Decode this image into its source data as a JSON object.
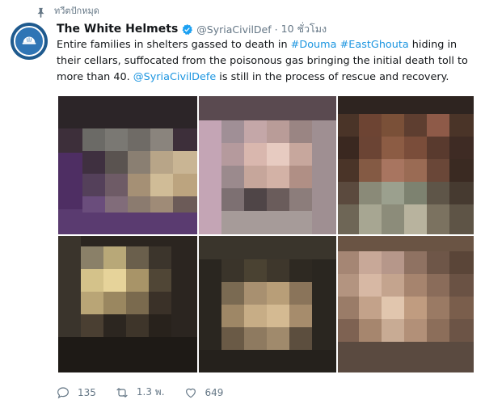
{
  "pinned_label": "ทวีตปักหมุด",
  "tweet": {
    "display_name": "The White Helmets",
    "handle": "@SyriaCivilDef",
    "time": "10 ชั่วโมง",
    "text_part1": "Entire families in shelters gassed to death in ",
    "hashtag1": "#Douma",
    "text_part2": " ",
    "hashtag2": "#EastGhouta",
    "text_part3": " hiding in their cellars, suffocated from the poisonous gas bringing the initial death toll to more than 40. ",
    "mention": "@SyriaCivilDefe",
    "text_part4": " is still in the process of rescue and recovery."
  },
  "actions": {
    "reply_count": "135",
    "retweet_count": "1.3 พ.",
    "like_count": "649"
  },
  "icons": {
    "pin": "pin-icon",
    "verified": "verified-badge-icon",
    "reply": "reply-icon",
    "retweet": "retweet-icon",
    "like": "heart-icon"
  },
  "colors": {
    "link": "#1b95e0",
    "muted": "#657786",
    "verified": "#1da1f2"
  }
}
